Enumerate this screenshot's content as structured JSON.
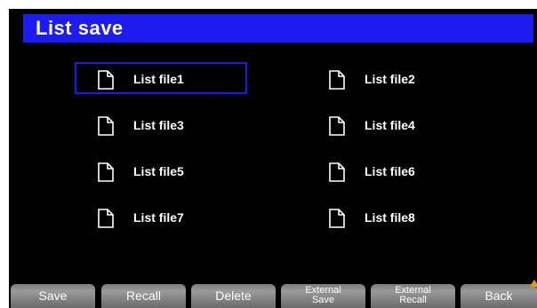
{
  "header": {
    "title": "List save"
  },
  "files": [
    {
      "label": "List file1",
      "selected": true
    },
    {
      "label": "List file2",
      "selected": false
    },
    {
      "label": "List file3",
      "selected": false
    },
    {
      "label": "List file4",
      "selected": false
    },
    {
      "label": "List file5",
      "selected": false
    },
    {
      "label": "List file6",
      "selected": false
    },
    {
      "label": "List file7",
      "selected": false
    },
    {
      "label": "List file8",
      "selected": false
    }
  ],
  "softkeys": {
    "save": "Save",
    "recall": "Recall",
    "delete": "Delete",
    "external_save": [
      "External",
      "Save"
    ],
    "external_recall": [
      "External",
      "Recall"
    ],
    "back": "Back"
  },
  "colors": {
    "accent": "#1c1cf0",
    "background": "#000000",
    "back_indicator": "#e8a000"
  },
  "icons": {
    "file": "document-icon",
    "back": "up-arrow-icon"
  }
}
